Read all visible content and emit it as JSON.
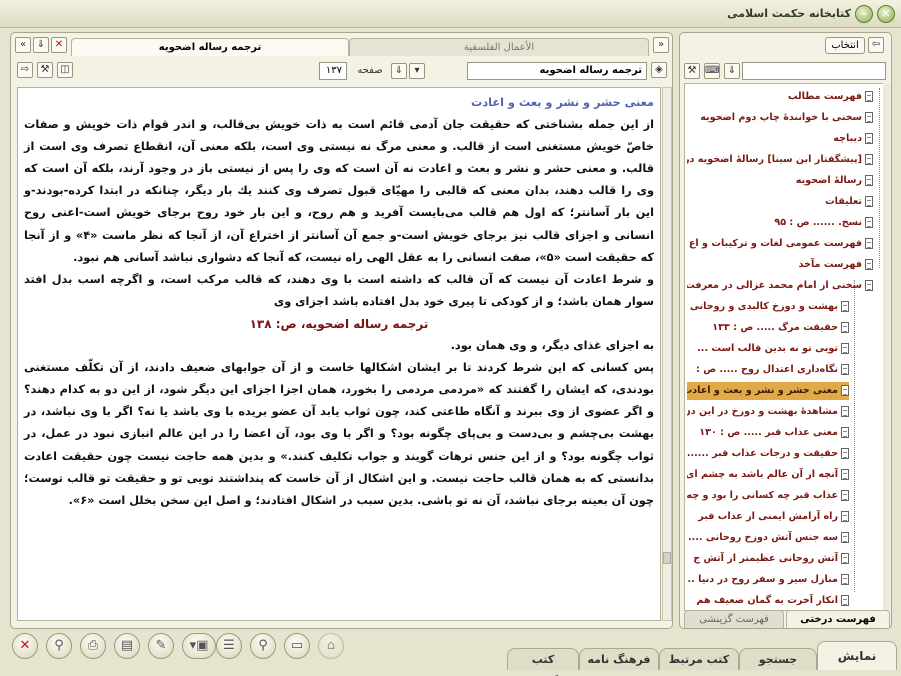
{
  "app": {
    "title": "كتابخانه حكمت اسلامی"
  },
  "doc_panel": {
    "tabs": [
      {
        "label": "ترجمه رساله اضحويه",
        "active": true
      },
      {
        "label": "الأعمال الفلسفية",
        "active": false
      }
    ],
    "book_field": "ترجمه رساله اضحويه",
    "page_label": "صفحه",
    "page_value": "۱۳۷"
  },
  "doc": {
    "heading": "معنی حشر و نشر و بعث و اعادت",
    "p1": "از این جمله بشناختی که حقیقت جان آدمی قائم است به ذات خویش بی‌قالب، و اندر قوام ذات خویش و صفات خاصّ خویش مستغنی است از قالب. و معنی مرگ نه نیستی وی است، بلکه معنی آن، انقطاع تصرف وی است از قالب. و معنی حشر و نشر و بعث و اعادت نه آن است که وی را پس از نیستی باز در وجود آرند، بلکه آن است که وی را قالب دهند، بدان معنی که قالبی را مهیّای قبول تصرف وی کنند یك بار دیگر، چنانکه در ابتدا کرده-بودند-و این بار آسانتر؛ که اول هم قالب می‌بایست آفرید و هم روح، و این بار خود روح برجای خویش است-اعنی روح انسانی و اجزای قالب نیز برجای خویش است-و جمع آن آسانتر از اختراع آن، از آنجا که نظر ماست «۴» و از آنجا که حقیقت است «۵»، صفت انسانی را به عقل الهی راه نیست، که آنجا که دشواری نباشد آسانی هم نبود.",
    "p2": "و شرط اعادت آن نیست که آن قالب که داشته است با وی دهند، که قالب مرکب است، و اگرچه اسب بدل افتد سوار همان باشد؛ و از کودکی تا پیری خود بدل افتاده باشد اجزای وی",
    "page_marker": "ترجمه رساله اضحويه، ص: ۱۳۸",
    "p3": "به اجزای غذای دیگر، و وی همان بود.",
    "p4": "پس کسانی که این شرط کردند تا بر ایشان اشکالها خاست و از آن جوابهای ضعیف دادند، از آن تکلّف مستغنی بودندی، که ایشان را گفتند که «مردمی مردمی را بخورد، همان اجزا اجزای این دیگر شود، از این دو به کدام دهند؟ و اگر عضوی از وی ببرند و آنگاه طاعتی کند، چون ثواب یابد آن عضو بریده با وی باشد یا نه؟ اگر با وی نباشد، در بهشت بی‌چشم و بی‌دست و بی‌پای چگونه بود؟ و اگر با وی بود، آن اعضا را در این عالم انبازی نبود در عمل، در ثواب چگونه بود؟ و از این جنس ترهات گویند و جواب تکلیف کنند.» و بدین همه حاجت نیست چون حقیقت اعادت بدانستی که به همان قالب حاجت نیست. و این اشکال از آن خاست که پنداشتند تویی تو و حقیقت تو قالب توست؛ چون آن بعینه برجای نباشد، آن نه تو باشی. بدین سبب در اشکال افتادند؛ و اصل این سخن بخلل است «۶»."
  },
  "toc_panel": {
    "select_label": "انتخاب",
    "search_placeholder": "",
    "items": [
      "فهرست مطالب",
      "سخنی با خوانندهٔ چاپ دوم اضحویه",
      "دیباچه",
      "[پیشگفتار ابن سینا] رسالهٔ اضحویه در",
      "رسالهٔ اضحویه",
      "تعلیقات",
      "نسخ. ...... ص : ۹۵",
      "فهرست عمومی لغات و ترکیبات و اع",
      "فهرست مآخذ",
      "سخنی از امام محمد غزالی در معرفت",
      "بهشت و دوزخ کالبدی و روحانی",
      "حقیقت مرگ ..... ص : ۱۳۳",
      "تویی تو نه بدین قالب است ...",
      "نگاه‌داری اعتدال روح ..... ص :",
      "معنی حشر و نشر و بعث و اعادت",
      "مشاهدهٔ بهشت و دوزخ در این دن",
      "معنی عذاب قبر ..... ص : ۱۳۰",
      "حقیقت و درجات عذاب قبر .......",
      "آنچه از آن عالم باشد به چشم ای",
      "عذاب قبر چه کسانی را بود و چه",
      "راه آرامش ایمنی از عذاب قبر",
      "سه جنس آتش دوزخ روحانی .....",
      "آتش روحانی عظیمتر از آتش ج",
      "منازل سیر و سفر روح در دنیا ...",
      "انکار آخرت به گمان ضعیف هم"
    ],
    "tabs": [
      {
        "label": "فهرست درختی",
        "active": true
      },
      {
        "label": "فهرست گزینشی",
        "active": false
      }
    ]
  },
  "bottom_tabs": [
    {
      "label": "نمایش",
      "active": true
    },
    {
      "label": "جستجو",
      "active": false
    },
    {
      "label": "كتب مرتبط",
      "active": false
    },
    {
      "label": "فرهنگ نامه",
      "active": false
    },
    {
      "label": "كتب انگلیسی",
      "active": false
    }
  ],
  "colors": {
    "accent": "#e0aa47",
    "heading": "#5560b8",
    "toc_text": "#7a1a12",
    "panel_bg": "#f4f2e4"
  }
}
